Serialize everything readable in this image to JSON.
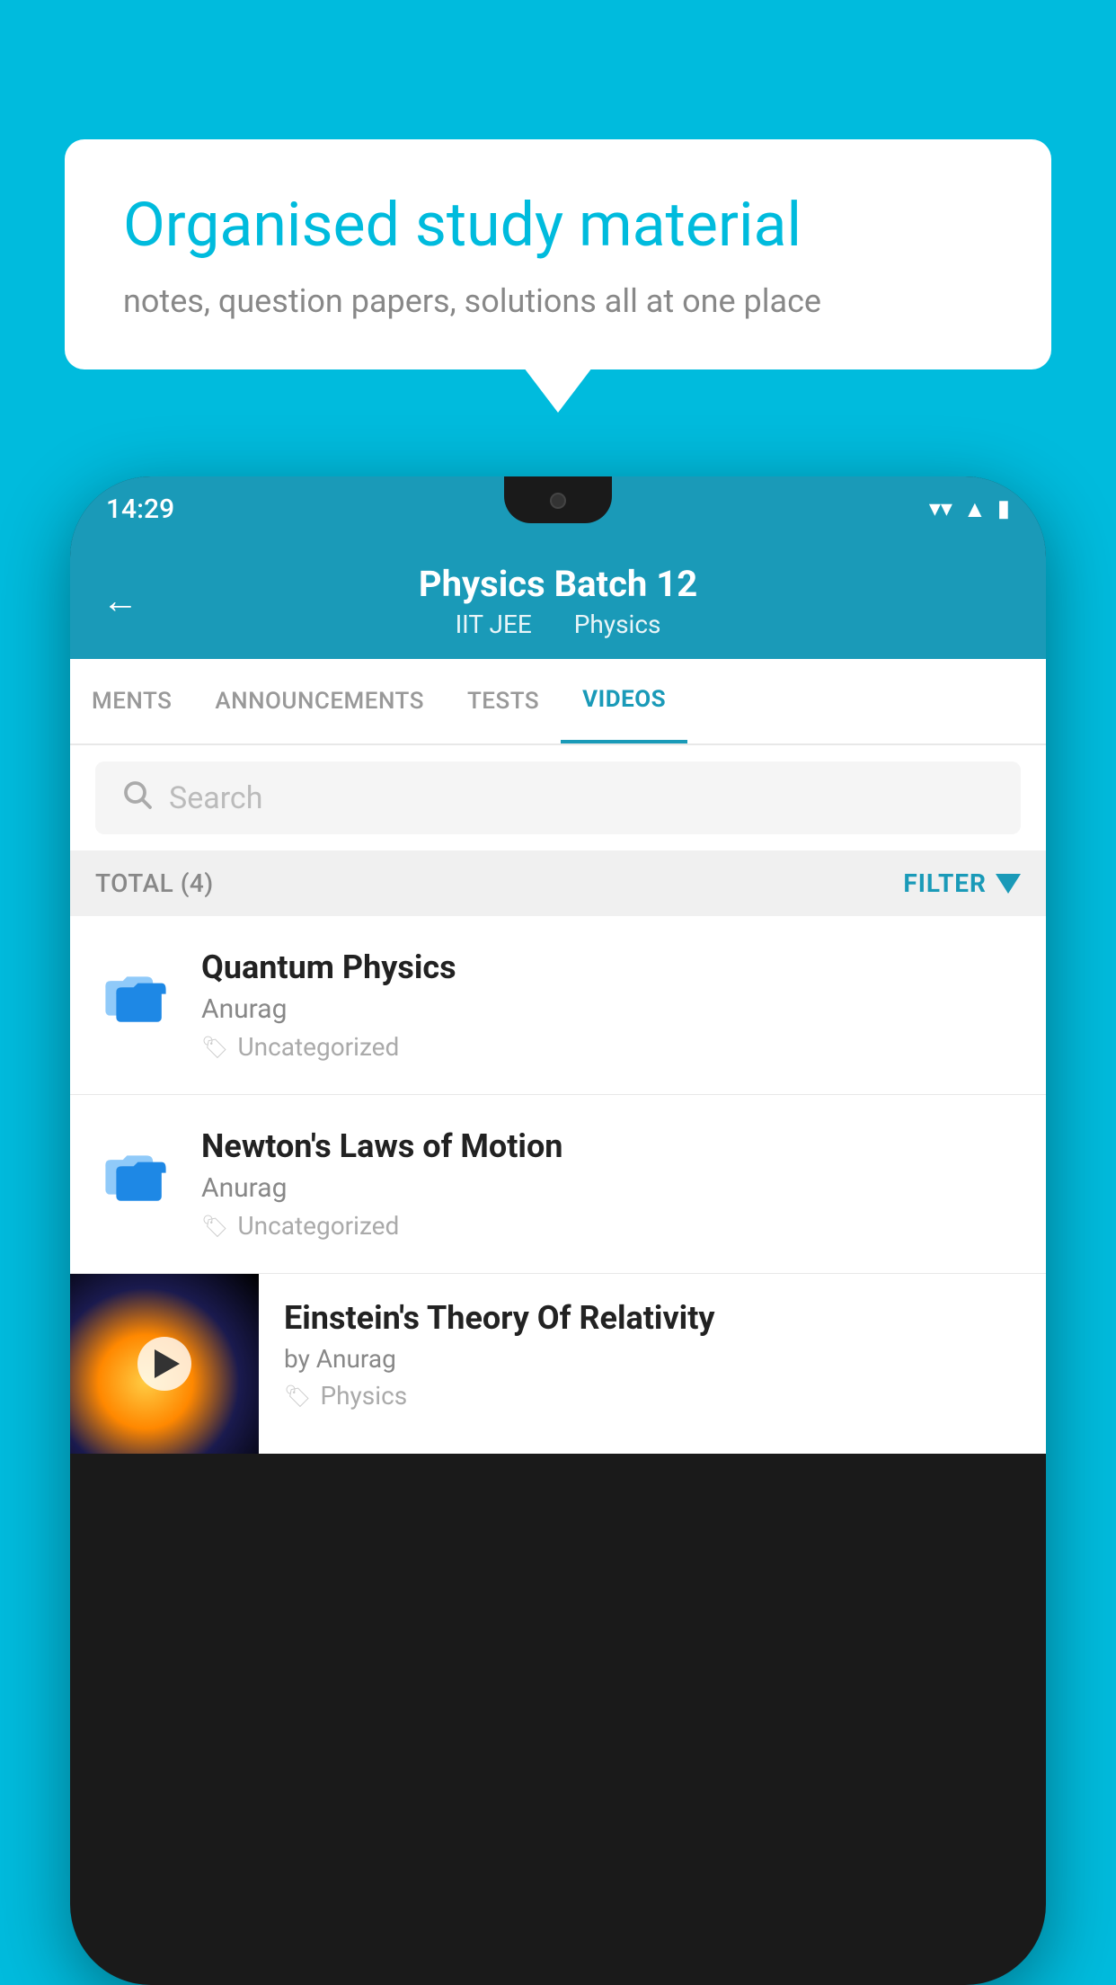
{
  "background_color": "#00BBDD",
  "speech_bubble": {
    "title": "Organised study material",
    "subtitle": "notes, question papers, solutions all at one place"
  },
  "phone": {
    "status_bar": {
      "time": "14:29",
      "icons": [
        "wifi",
        "signal",
        "battery"
      ]
    },
    "header": {
      "back_label": "←",
      "title": "Physics Batch 12",
      "subtitle_left": "IIT JEE",
      "subtitle_right": "Physics"
    },
    "tabs": [
      {
        "label": "MENTS",
        "active": false
      },
      {
        "label": "ANNOUNCEMENTS",
        "active": false
      },
      {
        "label": "TESTS",
        "active": false
      },
      {
        "label": "VIDEOS",
        "active": true
      }
    ],
    "search": {
      "placeholder": "Search"
    },
    "filter_bar": {
      "total_label": "TOTAL (4)",
      "filter_label": "FILTER"
    },
    "video_list": [
      {
        "id": 1,
        "title": "Quantum Physics",
        "author": "Anurag",
        "tag": "Uncategorized",
        "has_thumbnail": false
      },
      {
        "id": 2,
        "title": "Newton's Laws of Motion",
        "author": "Anurag",
        "tag": "Uncategorized",
        "has_thumbnail": false
      },
      {
        "id": 3,
        "title": "Einstein's Theory Of Relativity",
        "author": "by Anurag",
        "tag": "Physics",
        "has_thumbnail": true
      }
    ]
  }
}
